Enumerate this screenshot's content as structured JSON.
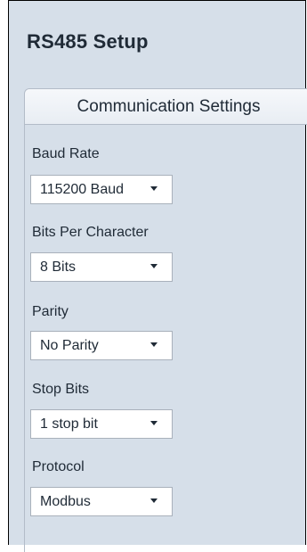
{
  "setup": {
    "title": "RS485 Setup",
    "group_title": "Communication Settings",
    "fields": [
      {
        "label": "Baud Rate",
        "value": "115200 Baud"
      },
      {
        "label": "Bits Per Character",
        "value": "8 Bits"
      },
      {
        "label": "Parity",
        "value": "No Parity"
      },
      {
        "label": "Stop Bits",
        "value": "1 stop bit"
      },
      {
        "label": "Protocol",
        "value": "Modbus"
      }
    ]
  }
}
